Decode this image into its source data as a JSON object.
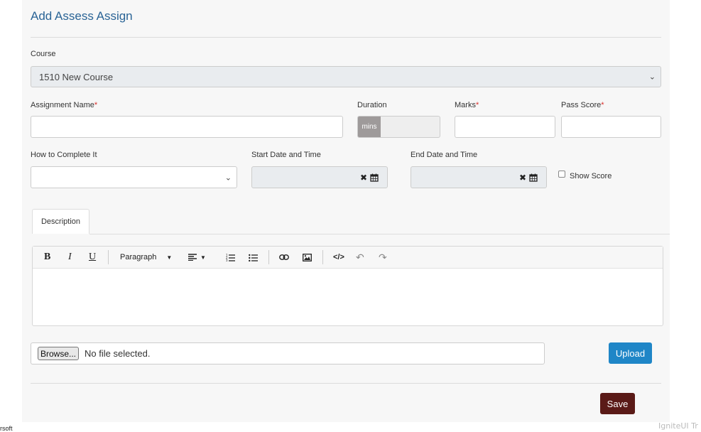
{
  "form": {
    "title": "Add Assess Assign",
    "course_label": "Course",
    "course_value": "1510 New Course",
    "assignment_name_label": "Assignment Name",
    "duration_label": "Duration",
    "duration_addon": "mins",
    "marks_label": "Marks",
    "pass_score_label": "Pass Score",
    "required_mark": "*",
    "how_label": "How to Complete It",
    "start_label": "Start Date and Time",
    "end_label": "End Date and Time",
    "show_score_label": "Show Score",
    "show_score_checked": false
  },
  "editor": {
    "tab_label": "Description",
    "paragraph_label": "Paragraph",
    "toolbar_icons": [
      "bold-icon",
      "italic-icon",
      "underline-icon",
      "paragraph-dropdown",
      "align-icon",
      "ordered-list-icon",
      "unordered-list-icon",
      "link-icon",
      "image-icon",
      "code-icon",
      "undo-icon",
      "redo-icon"
    ]
  },
  "upload": {
    "browse_label": "Browse...",
    "no_file_text": "No file selected.",
    "upload_label": "Upload"
  },
  "actions": {
    "save_label": "Save"
  },
  "footer": {
    "left_text": "rsoft",
    "right_text": "IgniteUI Tr"
  },
  "colors": {
    "title": "#2a6496",
    "upload": "#1f86c7",
    "save": "#5a1a17",
    "required": "#d9302c"
  }
}
